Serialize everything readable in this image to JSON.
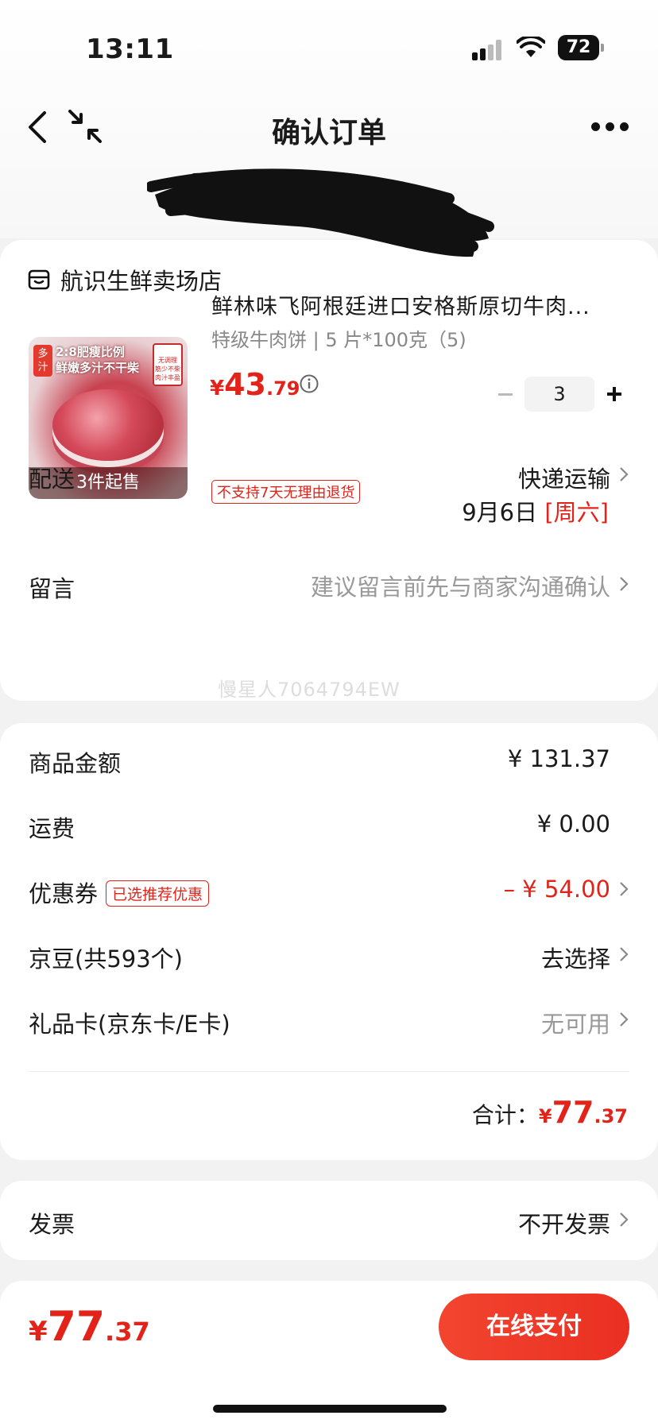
{
  "status_bar": {
    "time": "13:11",
    "battery": "72"
  },
  "nav": {
    "title": "确认订单"
  },
  "shop": {
    "name": "航识生鲜卖场店"
  },
  "product": {
    "image_tag": "多汁",
    "image_caption_1": "2:8肥瘦比例",
    "image_caption_2": "鲜嫩多汁不干柴",
    "image_badge": "无调理 筋少不柴 肉汁丰盈",
    "min_sale": "3件起售",
    "title": "鲜林味飞阿根廷进口安格斯原切牛肉...",
    "spec": "特级牛肉饼 | 5 片*100克（5)",
    "price_symbol": "¥",
    "price_int": "43",
    "price_dec": ".79",
    "quantity": "3",
    "no_return_tag": "不支持7天无理由退货"
  },
  "delivery": {
    "label": "配送",
    "method": "快递运输",
    "date": "9月6日",
    "weekday": "[周六]"
  },
  "message": {
    "label": "留言",
    "placeholder": "建议留言前先与商家沟通确认"
  },
  "watermark": "慢星人7064794EW",
  "summary": {
    "goods_label": "商品金额",
    "goods_value": "¥ 131.37",
    "shipping_label": "运费",
    "shipping_value": "¥ 0.00",
    "coupon_label": "优惠券",
    "coupon_tag": "已选推荐优惠",
    "coupon_value": "– ¥ 54.00",
    "beans_label": "京豆(共593个)",
    "beans_value": "去选择",
    "giftcard_label": "礼品卡(京东卡/E卡)",
    "giftcard_value": "无可用",
    "total_label": "合计：",
    "total_symbol": "¥",
    "total_int": "77",
    "total_dec": ".37"
  },
  "invoice": {
    "label": "发票",
    "value": "不开发票"
  },
  "footer": {
    "total_symbol": "¥",
    "total_int": "77",
    "total_dec": ".37",
    "pay_label": "在线支付"
  },
  "colors": {
    "accent": "#e2231a",
    "pay_button": "#ea2f22",
    "background": "#f2f2f2"
  }
}
